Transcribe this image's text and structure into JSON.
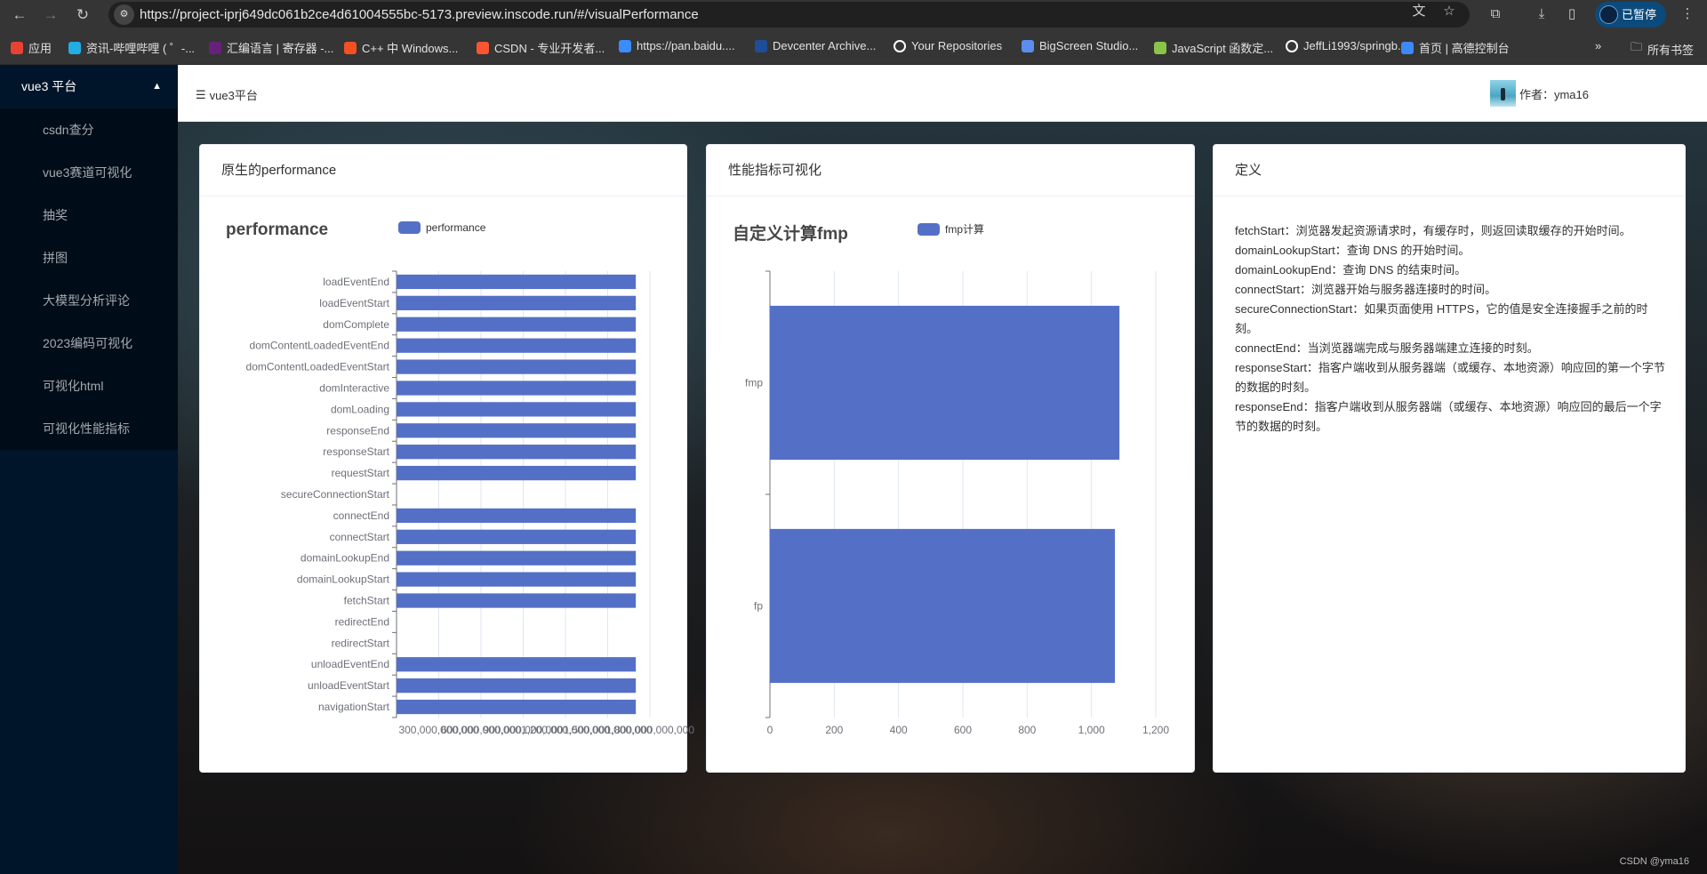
{
  "browser": {
    "url": "https://project-iprj649dc061b2ce4d61004555bc-5173.preview.inscode.run/#/visualPerformance",
    "profile_label": "已暂停",
    "bookmarks": [
      {
        "label": "应用",
        "icon": "apps-grid-icon",
        "color": "#e94235"
      },
      {
        "label": "资讯-哔哩哔哩 ( ゜-...",
        "icon": "bilibili-icon",
        "color": "#23ade5"
      },
      {
        "label": "汇编语言 | 寄存器 -...",
        "icon": "visual-studio-icon",
        "color": "#68217a"
      },
      {
        "label": "C++ 中 Windows...",
        "icon": "microsoft-icon",
        "color": "#f25022"
      },
      {
        "label": "CSDN - 专业开发者...",
        "icon": "csdn-icon",
        "color": "#fc5531"
      },
      {
        "label": "https://pan.baidu....",
        "icon": "baidu-pan-icon",
        "color": "#3b8cff"
      },
      {
        "label": "Devcenter Archive...",
        "icon": "word-icon",
        "color": "#1e4e9a"
      },
      {
        "label": "Your Repositories",
        "icon": "github-icon",
        "color": "#ffffff"
      },
      {
        "label": "BigScreen Studio...",
        "icon": "bigscreen-icon",
        "color": "#5b8def"
      },
      {
        "label": "JavaScript 函数定...",
        "icon": "js-site-icon",
        "color": "#8bc34a"
      },
      {
        "label": "JeffLi1993/springb...",
        "icon": "github-icon",
        "color": "#ffffff"
      },
      {
        "label": "首页 | 高德控制台",
        "icon": "amap-icon",
        "color": "#3d8af7"
      }
    ],
    "more_label": "»",
    "all_bookmarks": "所有书签"
  },
  "sidebar": {
    "group": "vue3 平台",
    "items": [
      "csdn查分",
      "vue3赛道可视化",
      "抽奖",
      "拼图",
      "大模型分析评论",
      "2023编码可视化",
      "可视化html",
      "可视化性能指标"
    ]
  },
  "header": {
    "breadcrumb": "vue3平台",
    "author": "作者：yma16"
  },
  "cards": {
    "performance": {
      "title": "原生的performance"
    },
    "fmp": {
      "title": "性能指标可视化"
    },
    "definitions": {
      "title": "定义",
      "lines": [
        "fetchStart：浏览器发起资源请求时，有缓存时，则返回读取缓存的开始时间。",
        "domainLookupStart：查询 DNS 的开始时间。",
        "domainLookupEnd：查询 DNS 的结束时间。",
        "connectStart：浏览器开始与服务器连接时的时间。",
        "secureConnectionStart：如果页面使用 HTTPS，它的值是安全连接握手之前的时刻。",
        "connectEnd：当浏览器端完成与服务器端建立连接的时刻。",
        "responseStart：指客户端收到从服务器端（或缓存、本地资源）响应回的第一个字节的数据的时刻。",
        "responseEnd：指客户端收到从服务器端（或缓存、本地资源）响应回的最后一个字节的数据的时刻。"
      ]
    }
  },
  "watermark": "CSDN @yma16",
  "chart_data": [
    {
      "type": "bar",
      "orientation": "horizontal",
      "title": "performance",
      "legend": [
        "performance"
      ],
      "legend_position": "top",
      "color": "#5470c6",
      "categories": [
        "navigationStart",
        "unloadEventStart",
        "unloadEventEnd",
        "redirectStart",
        "redirectEnd",
        "fetchStart",
        "domainLookupStart",
        "domainLookupEnd",
        "connectStart",
        "connectEnd",
        "secureConnectionStart",
        "requestStart",
        "responseStart",
        "responseEnd",
        "domLoading",
        "domInteractive",
        "domContentLoadedEventStart",
        "domContentLoadedEventEnd",
        "domComplete",
        "loadEventStart",
        "loadEventEnd"
      ],
      "values": [
        1700000000000,
        1700000000000,
        1700000000000,
        0,
        0,
        1700000000000,
        1700000000000,
        1700000000000,
        1700000000000,
        1700000000000,
        0,
        1700000000000,
        1700000000000,
        1700000000000,
        1700000000000,
        1700000000000,
        1700000000000,
        1700000000000,
        1700000000000,
        1700000000000,
        1700000000000
      ],
      "xlim": [
        0,
        1800000000000
      ],
      "xticks": [
        "300,000,000,000",
        "600,000,000,000",
        "900,000,000,000",
        "1,200,000,000,000",
        "1,500,000,000,000",
        "1,800,000,000,000"
      ],
      "grid": true
    },
    {
      "type": "bar",
      "orientation": "horizontal",
      "title": "自定义计算fmp",
      "legend": [
        "fmp计算"
      ],
      "legend_position": "top",
      "color": "#5470c6",
      "categories": [
        "fp",
        "fmp"
      ],
      "values": [
        1073,
        1087
      ],
      "xlim": [
        0,
        1200
      ],
      "xticks": [
        "0",
        "200",
        "400",
        "600",
        "800",
        "1,000",
        "1,200"
      ],
      "grid": true
    }
  ]
}
